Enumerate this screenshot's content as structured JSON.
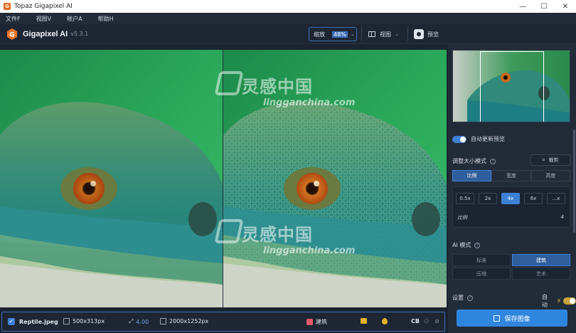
{
  "window": {
    "title": "Topaz Gigapixel AI",
    "minimize": "—",
    "maximize": "☐",
    "close": "✕"
  },
  "menu": [
    "文件F",
    "视图V",
    "帐户A",
    "帮助H"
  ],
  "header": {
    "app_name": "Gigapixel AI",
    "version": "v5.3.1",
    "zoom_label": "缩放",
    "zoom_value": "48%",
    "view_label": "视图",
    "preview_label": "预览"
  },
  "watermark": {
    "text": "灵感中国",
    "url": "lingganchina.com"
  },
  "status": {
    "filename": "Reptile.jpeg",
    "input_size": "500x313px",
    "scale": "4.00",
    "output_size": "2000x1252px",
    "mode": "建筑",
    "cb": "CB"
  },
  "panel": {
    "auto_update_label": "自动更新预览",
    "resize_mode_label": "调整大小模式",
    "help_glyph": "?",
    "crop_label": "裁剪",
    "resize_tabs": [
      {
        "label": "比例",
        "active": true
      },
      {
        "label": "宽度",
        "active": false
      },
      {
        "label": "高度",
        "active": false
      }
    ],
    "scale_buttons": [
      {
        "label": "0.5x",
        "active": false
      },
      {
        "label": "2x",
        "active": false
      },
      {
        "label": "4x",
        "active": true
      },
      {
        "label": "6x",
        "active": false
      },
      {
        "label": "...x",
        "active": false
      }
    ],
    "scale_field_label": "比例",
    "scale_field_value": "4",
    "ai_mode_label": "AI 模式",
    "ai_modes": [
      {
        "label": "标准",
        "active": false
      },
      {
        "label": "建筑",
        "active": true
      },
      {
        "label": "压缩",
        "active": false
      },
      {
        "label": "艺术",
        "active": false
      }
    ],
    "settings_label": "设置",
    "auto_label": "自动",
    "save_label": "保存图像"
  },
  "colors": {
    "accent": "#3d80d6",
    "save": "#2f86de",
    "background": "#1b2330",
    "panel": "#222b38"
  }
}
